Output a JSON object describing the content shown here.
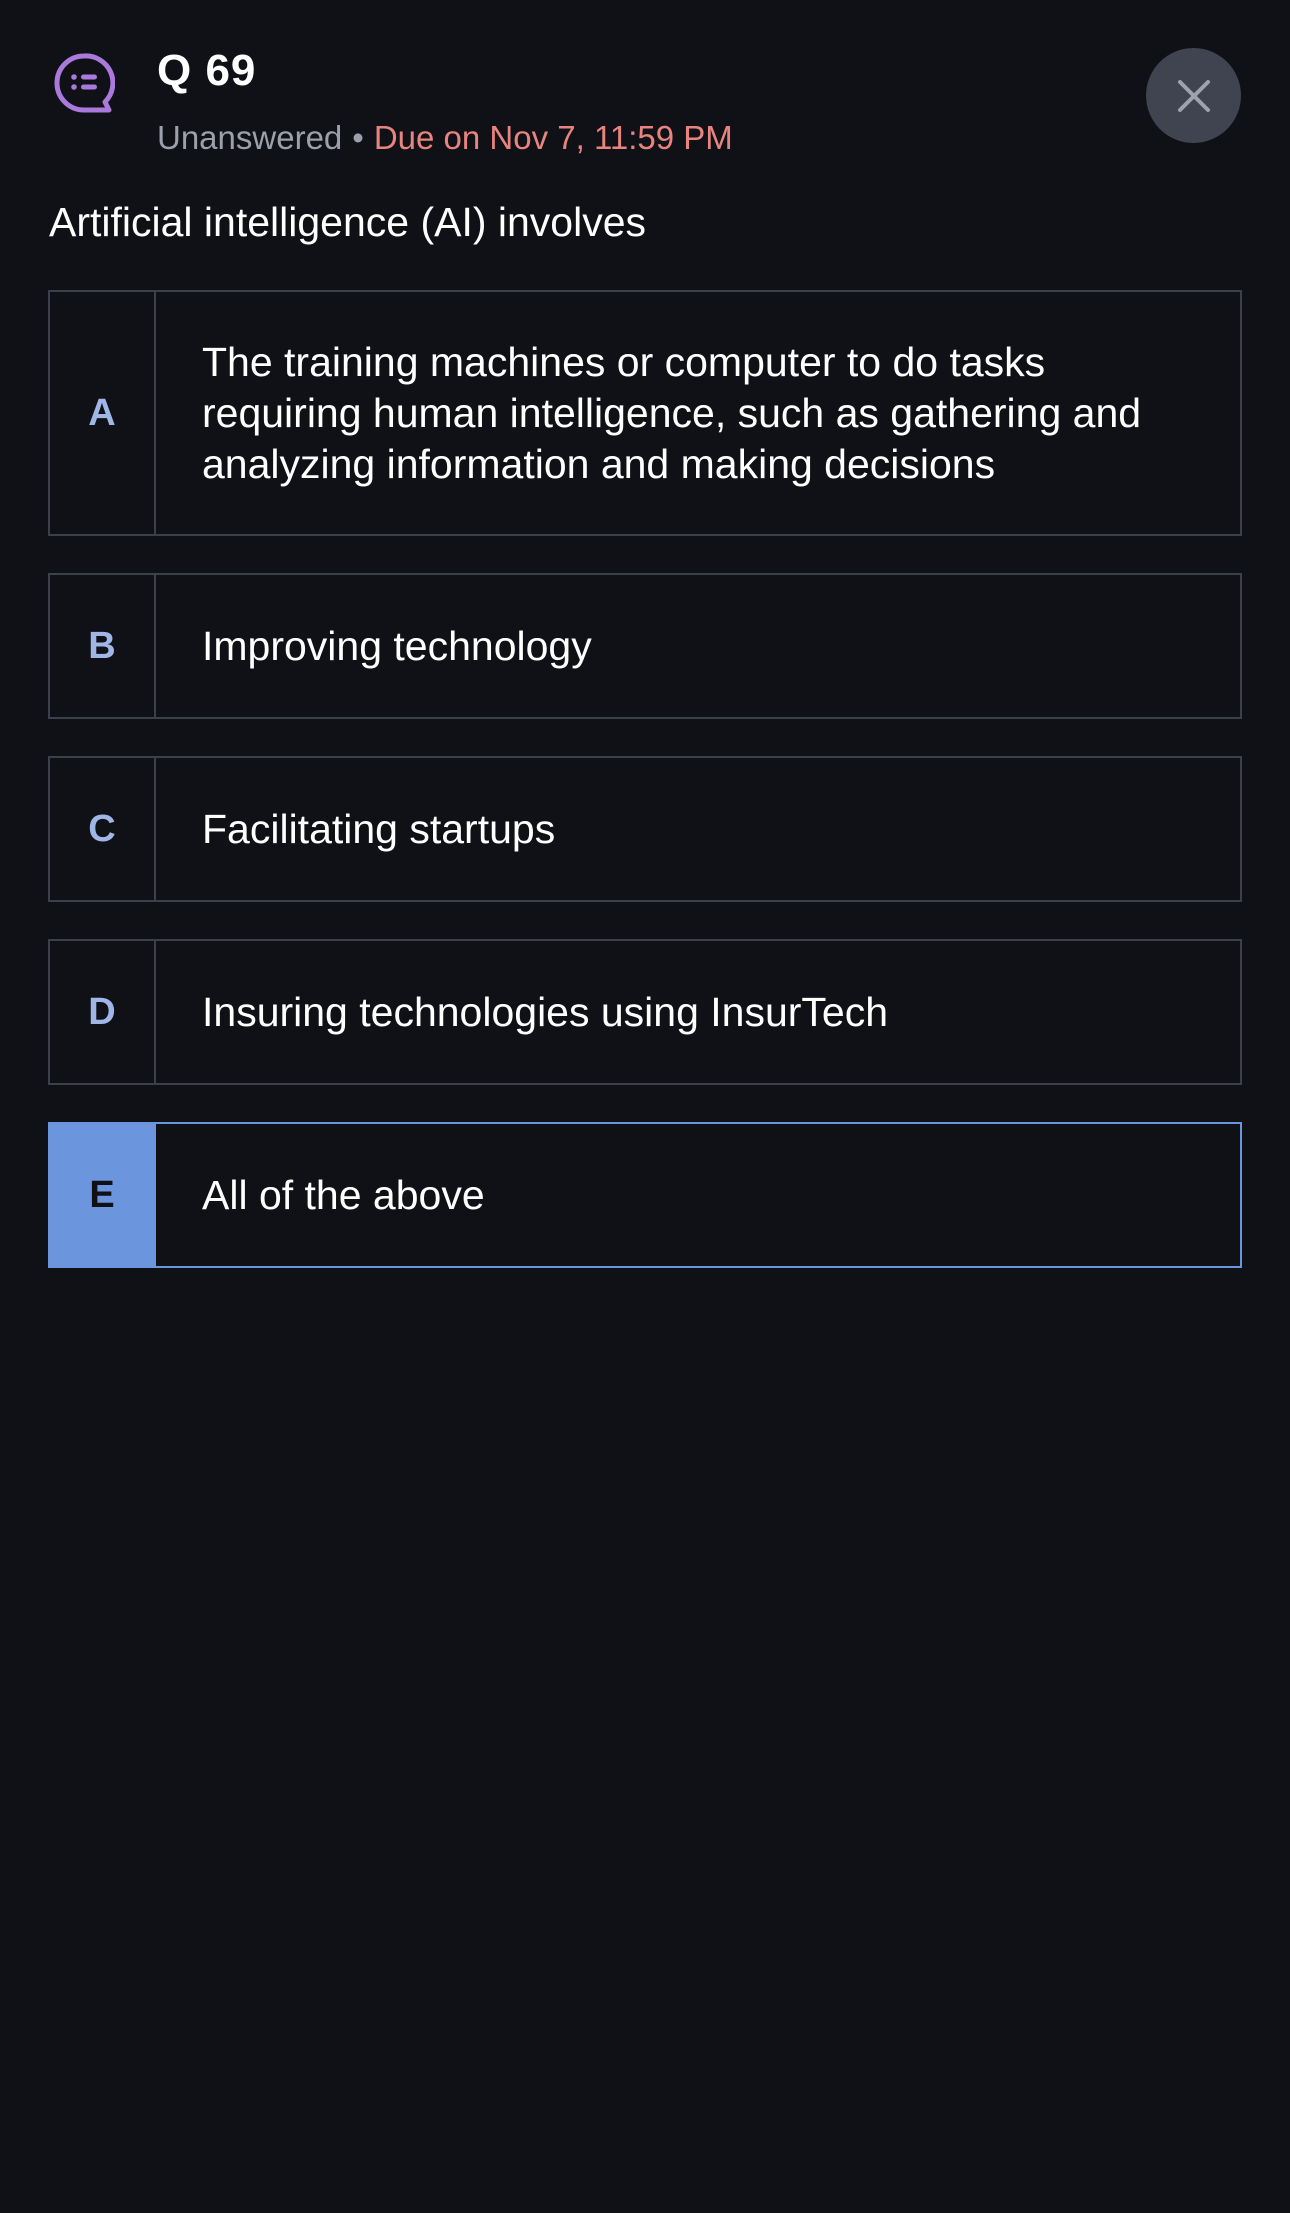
{
  "header": {
    "title": "Q 69",
    "status": "Unanswered",
    "separator": "•",
    "due": "Due on Nov 7, 11:59 PM"
  },
  "icons": {
    "poll": "chat-list-icon",
    "close": "close-icon"
  },
  "colors": {
    "background": "#0f1116",
    "accent": "#6b96de",
    "due_text": "#e8847f",
    "icon_purple": "#a979db"
  },
  "question": {
    "text": "Artificial intelligence (AI) involves"
  },
  "options": [
    {
      "letter": "A",
      "text": "The training machines or computer to do tasks requiring human intelligence, such as gathering and analyzing information and making decisions",
      "selected": false
    },
    {
      "letter": "B",
      "text": "Improving technology",
      "selected": false
    },
    {
      "letter": "C",
      "text": "Facilitating startups",
      "selected": false
    },
    {
      "letter": "D",
      "text": "Insuring technologies using InsurTech",
      "selected": false
    },
    {
      "letter": "E",
      "text": "All of the above",
      "selected": true
    }
  ]
}
